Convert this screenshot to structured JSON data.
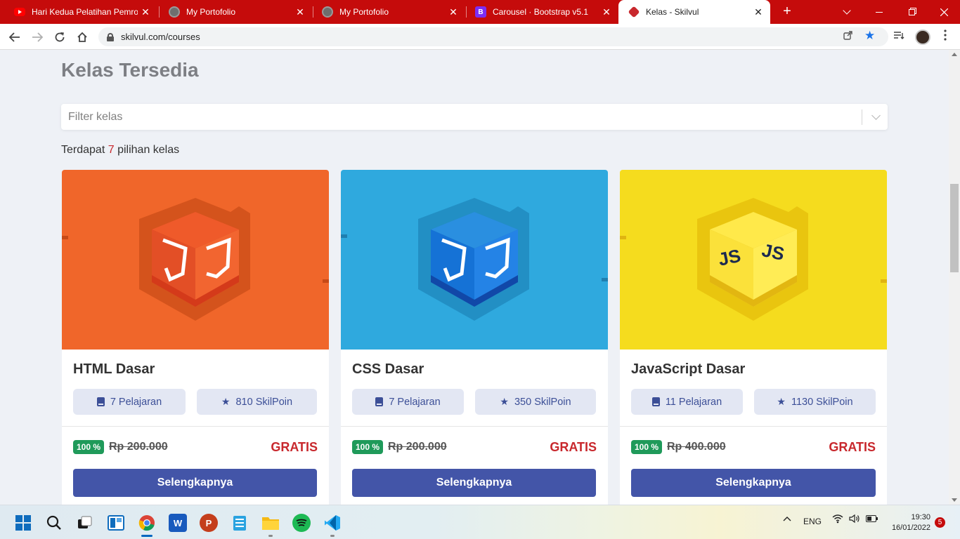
{
  "browser": {
    "tabs": [
      {
        "title": "Hari Kedua Pelatihan Pemrog",
        "favicon": "youtube-icon",
        "active": false
      },
      {
        "title": "My Portofolio",
        "favicon": "globe-icon",
        "active": false
      },
      {
        "title": "My Portofolio",
        "favicon": "globe-icon",
        "active": false
      },
      {
        "title": "Carousel · Bootstrap v5.1",
        "favicon": "bootstrap-icon",
        "active": false
      },
      {
        "title": "Kelas - Skilvul",
        "favicon": "skilvul-icon",
        "active": true
      }
    ],
    "close_glyph": "✕",
    "new_tab_glyph": "+",
    "url": "skilvul.com/courses",
    "tabbar_color": "#c50b0b"
  },
  "page": {
    "title": "Kelas Tersedia",
    "filter_placeholder": "Filter kelas",
    "count_prefix": "Terdapat",
    "count": "7",
    "count_suffix": "pilihan kelas",
    "accent_color": "#4355a8",
    "courses": [
      {
        "title": "HTML Dasar",
        "lessons": "7 Pelajaran",
        "points": "810 SkilPoin",
        "badge": "100 %",
        "old_price": "Rp 200.000",
        "price": "GRATIS",
        "button": "Selengkapnya",
        "image_bg": "#f0662a",
        "logo": "html5-cube-icon"
      },
      {
        "title": "CSS Dasar",
        "lessons": "7 Pelajaran",
        "points": "350 SkilPoin",
        "badge": "100 %",
        "old_price": "Rp 200.000",
        "price": "GRATIS",
        "button": "Selengkapnya",
        "image_bg": "#2fa9de",
        "logo": "css3-cube-icon"
      },
      {
        "title": "JavaScript Dasar",
        "lessons": "11 Pelajaran",
        "points": "1130 SkilPoin",
        "badge": "100 %",
        "old_price": "Rp 400.000",
        "price": "GRATIS",
        "button": "Selengkapnya",
        "image_bg": "#f5dc1e",
        "logo": "js-cube-icon"
      }
    ]
  },
  "taskbar": {
    "language": "ENG",
    "time": "19:30",
    "date": "16/01/2022",
    "notifications": "5",
    "apps": [
      "windows-start-icon",
      "search-icon",
      "task-view-icon",
      "widgets-icon",
      "chrome-icon",
      "word-icon",
      "powerpoint-icon",
      "notepad-icon",
      "file-explorer-icon",
      "spotify-icon",
      "vscode-icon"
    ]
  }
}
